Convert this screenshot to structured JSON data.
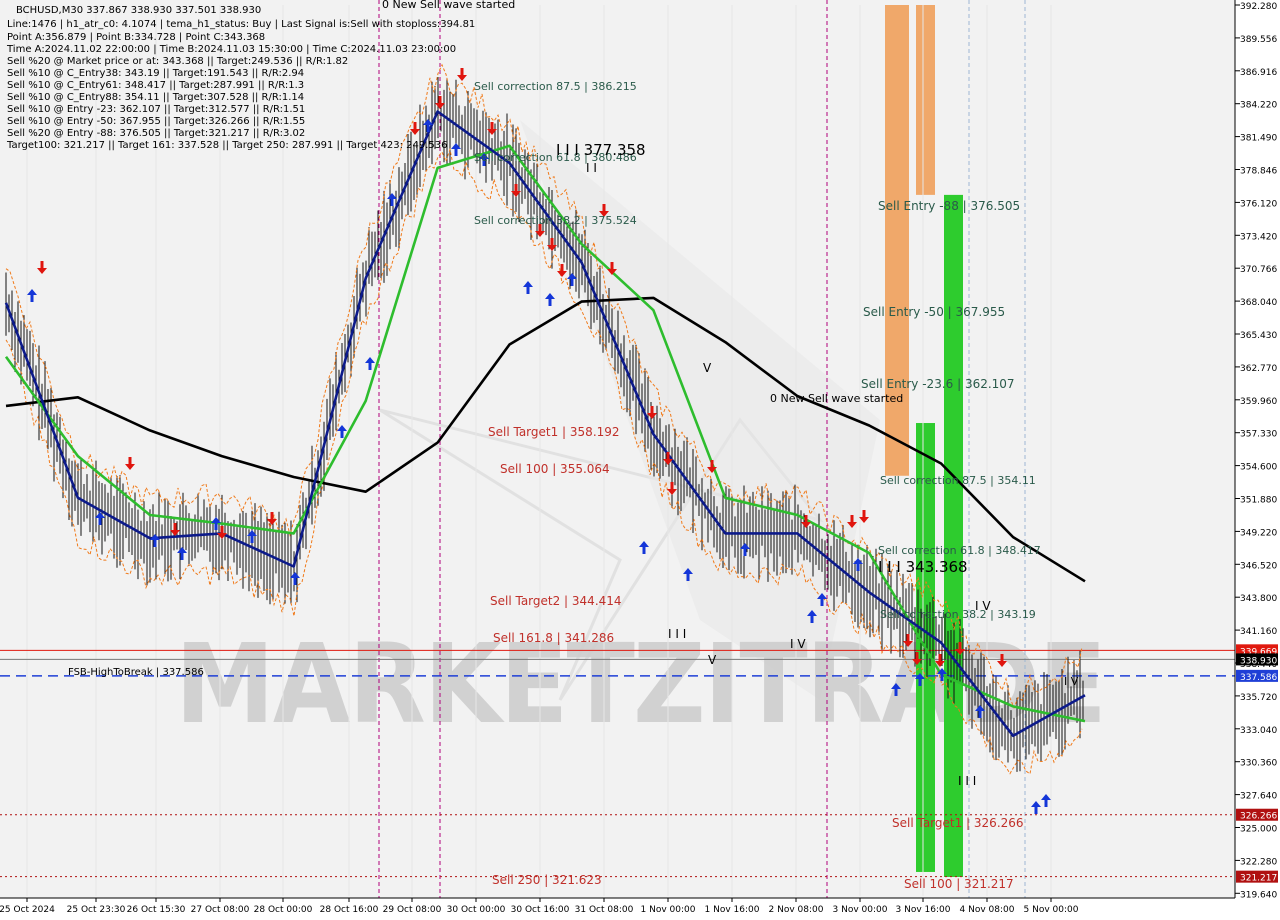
{
  "header": {
    "symbol_line": "BCHUSD,M30  337.867 338.930 337.501 338.930",
    "lines": [
      "Line:1476  |  h1_atr_c0: 4.1074  |  tema_h1_status: Buy  |  Last Signal is:Sell with stoploss:394.81",
      "Point A:356.879  |  Point B:334.728  |  Point C:343.368",
      "Time A:2024.11.02 22:00:00  |  Time B:2024.11.03 15:30:00  |  Time C:2024.11.03 23:00:00",
      "Sell %20 @ Market price or at: 343.368  ||  Target:249.536  ||  R/R:1.82",
      "Sell %10 @ C_Entry38: 343.19  ||  Target:191.543  ||  R/R:2.94",
      "Sell %10 @ C_Entry61: 348.417  ||  Target:287.991  ||  R/R:1.3",
      "Sell %10 @ C_Entry88: 354.11  ||  Target:307.528  ||  R/R:1.14",
      "Sell %10 @ Entry -23: 362.107  ||  Target:312.577  ||  R/R:1.51",
      "Sell %10 @ Entry -50: 367.955  ||  Target:326.266  ||  R/R:1.55",
      "Sell %20 @ Entry -88: 376.505  ||  Target:321.217  ||  R/R:3.02",
      "Target100: 321.217  ||  Target 161: 337.528  ||  Target 250: 287.991  ||  Target 423: 249.536"
    ]
  },
  "watermark": "MARKETZITRADE",
  "price_axis": {
    "ticks": [
      "392.280",
      "389.556",
      "386.916",
      "384.220",
      "381.490",
      "378.846",
      "376.120",
      "373.420",
      "370.766",
      "368.040",
      "365.430",
      "362.770",
      "359.960",
      "357.330",
      "354.600",
      "351.880",
      "349.220",
      "346.520",
      "343.800",
      "341.160",
      "338.440",
      "335.720",
      "333.040",
      "330.360",
      "327.640",
      "325.000",
      "322.280",
      "319.640"
    ],
    "tags": [
      {
        "label": "339.669",
        "price": 339.669,
        "color": "#e0190f"
      },
      {
        "label": "338.930",
        "price": 338.93,
        "color": "#000000"
      },
      {
        "label": "337.586",
        "price": 337.586,
        "color": "#1f3fd6"
      },
      {
        "label": "326.266",
        "price": 326.266,
        "color": "#b01010"
      },
      {
        "label": "321.217",
        "price": 321.217,
        "color": "#b01010"
      }
    ]
  },
  "time_axis": {
    "labels": [
      "25 Oct 2024",
      "25 Oct 23:30",
      "26 Oct 15:30",
      "27 Oct 08:00",
      "28 Oct 00:00",
      "28 Oct 16:00",
      "29 Oct 08:00",
      "30 Oct 00:00",
      "30 Oct 16:00",
      "31 Oct 08:00",
      "1 Nov 00:00",
      "1 Nov 16:00",
      "2 Nov 08:00",
      "3 Nov 00:00",
      "3 Nov 16:00",
      "4 Nov 08:00",
      "5 Nov 00:00"
    ]
  },
  "annotations": [
    {
      "text": "0 New Sell wave started",
      "color": "#000000",
      "key": "wave1"
    },
    {
      "text": "0 New Sell wave started",
      "color": "#000000",
      "key": "wave2"
    },
    {
      "text": "Sell correction 87.5 | 386.215",
      "color": "#2a5a4a",
      "key": "c1"
    },
    {
      "text": "Sell correction 61.8 | 380.486",
      "color": "#2a5a4a",
      "key": "c2"
    },
    {
      "text": "Sell correction 38.2 | 375.524",
      "color": "#2a5a4a",
      "key": "c3"
    },
    {
      "text": "I I I 377.358",
      "color": "#000000",
      "key": "p1"
    },
    {
      "text": "Sell Entry -88 | 376.505",
      "color": "#2a5a4a",
      "key": "e1"
    },
    {
      "text": "Sell Entry -50 | 367.955",
      "color": "#2a5a4a",
      "key": "e2"
    },
    {
      "text": "Sell Entry -23.6 | 362.107",
      "color": "#2a5a4a",
      "key": "e3"
    },
    {
      "text": "Sell Target1 | 358.192",
      "color": "#c0302a",
      "key": "t1"
    },
    {
      "text": "Sell 100 | 355.064",
      "color": "#c0302a",
      "key": "t2"
    },
    {
      "text": "Sell correction 87.5 | 354.11",
      "color": "#2a5a4a",
      "key": "c4"
    },
    {
      "text": "Sell correction 61.8 | 348.417",
      "color": "#2a5a4a",
      "key": "c5"
    },
    {
      "text": "I I I 343.368",
      "color": "#000000",
      "key": "p2"
    },
    {
      "text": "Sell correction 38.2 | 343.19",
      "color": "#2a5a4a",
      "key": "c6"
    },
    {
      "text": "Sell Target2 | 344.414",
      "color": "#c0302a",
      "key": "t3"
    },
    {
      "text": "Sell 161.8 | 341.286",
      "color": "#c0302a",
      "key": "t4"
    },
    {
      "text": "FSB-HighToBreak | 337.586",
      "color": "#000000",
      "key": "fsb"
    },
    {
      "text": "Sell Target1 | 326.266",
      "color": "#c0302a",
      "key": "t5"
    },
    {
      "text": "Sell 250 | 321.623",
      "color": "#c0302a",
      "key": "t6"
    },
    {
      "text": "Sell 100 | 321.217",
      "color": "#c0302a",
      "key": "t7"
    },
    {
      "text": "I I I",
      "color": "#000000",
      "key": "m1"
    },
    {
      "text": "I V",
      "color": "#000000",
      "key": "m2"
    },
    {
      "text": "V",
      "color": "#000000",
      "key": "m3"
    },
    {
      "text": "I V",
      "color": "#000000",
      "key": "m4"
    },
    {
      "text": "I I I",
      "color": "#000000",
      "key": "m5"
    },
    {
      "text": "V",
      "color": "#000000",
      "key": "m6"
    },
    {
      "text": "I I",
      "color": "#000000",
      "key": "m7"
    },
    {
      "text": "I V",
      "color": "#000000",
      "key": "m8"
    }
  ],
  "chart_data": {
    "type": "line",
    "title": "BCHUSD,M30",
    "ylim": [
      319.64,
      392.28
    ],
    "x_categories": [
      "25 Oct 2024",
      "25 Oct 23:30",
      "26 Oct 15:30",
      "27 Oct 08:00",
      "28 Oct 00:00",
      "28 Oct 16:00",
      "29 Oct 08:00",
      "30 Oct 00:00",
      "30 Oct 16:00",
      "31 Oct 08:00",
      "1 Nov 00:00",
      "1 Nov 16:00",
      "2 Nov 08:00",
      "3 Nov 00:00",
      "3 Nov 16:00",
      "4 Nov 08:00",
      "5 Nov 00:00"
    ],
    "series": [
      {
        "color": "#000000",
        "values": [
          359.6,
          360.3,
          357.6,
          355.5,
          353.8,
          352.6,
          356.6,
          364.6,
          368.1,
          368.4,
          364.8,
          360.4,
          358.0,
          354.9,
          348.9,
          345.3
        ]
      },
      {
        "color": "#2ebd2e",
        "values": [
          363.6,
          355.5,
          350.7,
          350.0,
          349.2,
          360.0,
          379.0,
          380.8,
          372.8,
          367.4,
          352.1,
          350.7,
          347.6,
          337.7,
          335.1,
          333.9
        ]
      },
      {
        "color": "#0c1a8a",
        "values": [
          368.0,
          352.1,
          348.8,
          349.2,
          346.5,
          370.0,
          383.6,
          379.4,
          371.3,
          357.3,
          349.2,
          349.2,
          344.4,
          340.3,
          332.7,
          336.0
        ]
      }
    ],
    "horizontal_levels": [
      {
        "price": 339.669,
        "style": "solid",
        "color": "#e0190f"
      },
      {
        "price": 338.93,
        "style": "solid",
        "color": "#777777"
      },
      {
        "price": 337.586,
        "style": "dashed",
        "color": "#1f3fd6"
      },
      {
        "price": 326.266,
        "style": "dotted",
        "color": "#b01010"
      },
      {
        "price": 321.217,
        "style": "dotted",
        "color": "#b01010"
      }
    ],
    "entry_zones": [
      {
        "top": 392.28,
        "bottom": 358.2,
        "color": "#f0a86a"
      },
      {
        "top": 392.28,
        "bottom": 353.9,
        "color": "#f0a86a"
      },
      {
        "top": 392.28,
        "bottom": 376.8,
        "color": "#f0a86a"
      },
      {
        "top": 358.2,
        "bottom": 321.6,
        "color": "#2ecc2e"
      },
      {
        "top": 353.9,
        "bottom": 321.2,
        "color": "#2ecc2e"
      },
      {
        "top": 376.8,
        "bottom": 321.2,
        "color": "#2ecc2e"
      }
    ]
  }
}
